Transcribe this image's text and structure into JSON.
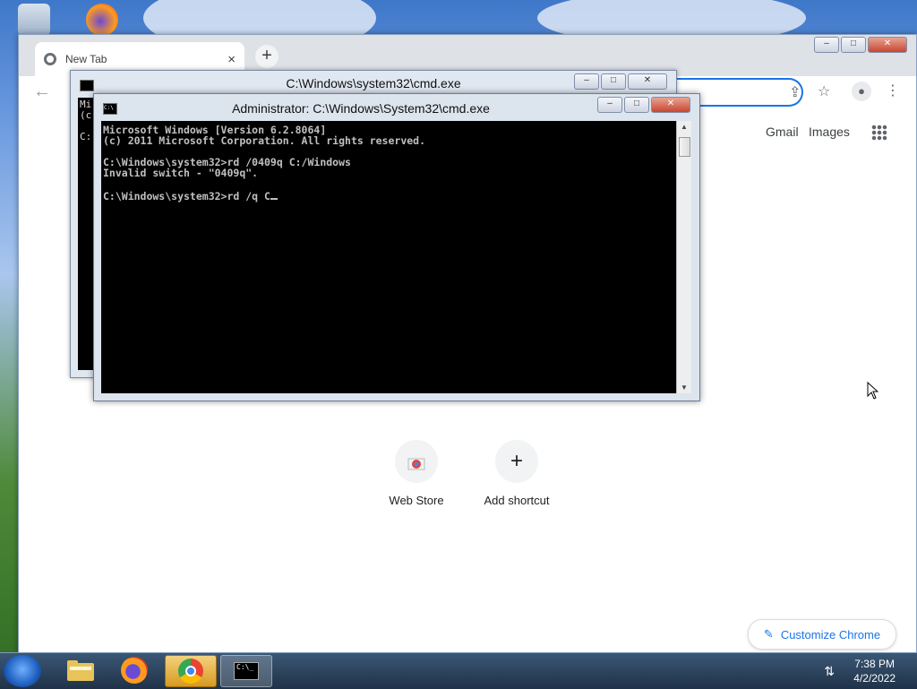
{
  "chrome": {
    "tab_title": "New Tab",
    "tab_close": "×",
    "new_tab": "+",
    "back": "←",
    "top_links": [
      "Gmail",
      "Images"
    ],
    "shortcuts": [
      {
        "label": "Web Store",
        "icon": "web-store-icon"
      },
      {
        "label": "Add shortcut",
        "icon": "plus-icon",
        "glyph": "+"
      }
    ],
    "customize_label": "Customize Chrome",
    "customize_glyph": "✎",
    "window_buttons": {
      "minimize": "–",
      "maximize": "□",
      "close": "✕"
    }
  },
  "cmd_back": {
    "title": "C:\\Windows\\system32\\cmd.exe",
    "lines": "Mi\n(c\n\nC:"
  },
  "cmd": {
    "title": "Administrator: C:\\Windows\\System32\\cmd.exe",
    "icon_text": "C:\\",
    "lines": [
      "Microsoft Windows [Version 6.2.8064]",
      "(c) 2011 Microsoft Corporation. All rights reserved.",
      "",
      "C:\\Windows\\system32>rd /0409q C:/Windows",
      "Invalid switch - \"0409q\".",
      "",
      "C:\\Windows\\system32>rd /q C"
    ],
    "window_buttons": {
      "minimize": "–",
      "maximize": "□",
      "close": "✕"
    }
  },
  "taskbar": {
    "items": [
      "file-explorer-icon",
      "firefox-icon",
      "chrome-icon",
      "cmd-icon"
    ],
    "cmd_icon_text": "C:\\_",
    "time": "7:38 PM",
    "date": "4/2/2022",
    "tray_glyph": "⇅"
  },
  "colors": {
    "accent": "#1a73e8",
    "console_bg": "#000000",
    "taskbar": "#1f3248"
  }
}
